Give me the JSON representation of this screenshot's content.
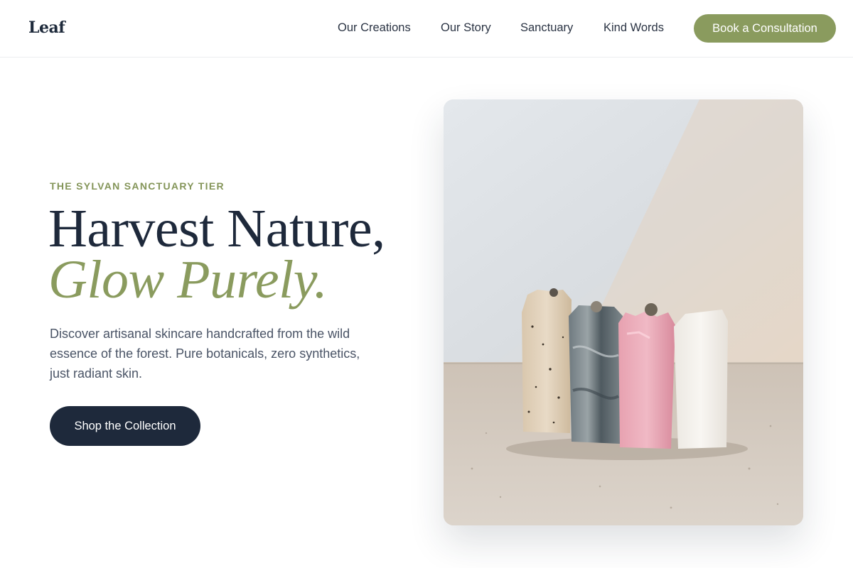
{
  "header": {
    "logo": "Leaf",
    "nav": [
      {
        "label": "Our Creations"
      },
      {
        "label": "Our Story"
      },
      {
        "label": "Sanctuary"
      },
      {
        "label": "Kind Words"
      }
    ],
    "cta_label": "Book a Consultation"
  },
  "hero": {
    "eyebrow": "THE SYLVAN SANCTUARY TIER",
    "headline_line1": "Harvest Nature,",
    "headline_line2": "Glow Purely.",
    "description": "Discover artisanal skincare handcrafted from the wild essence of the forest. Pure botanicals, zero synthetics, just radiant skin.",
    "button_label": "Shop the Collection",
    "image_subject": "Four handmade soap bars (speckled oat, charcoal swirl, pink, white) on stone surface"
  },
  "colors": {
    "accent": "#8a9b5e",
    "dark": "#1e293b",
    "text_muted": "#4a5466",
    "background": "#ffffff"
  }
}
